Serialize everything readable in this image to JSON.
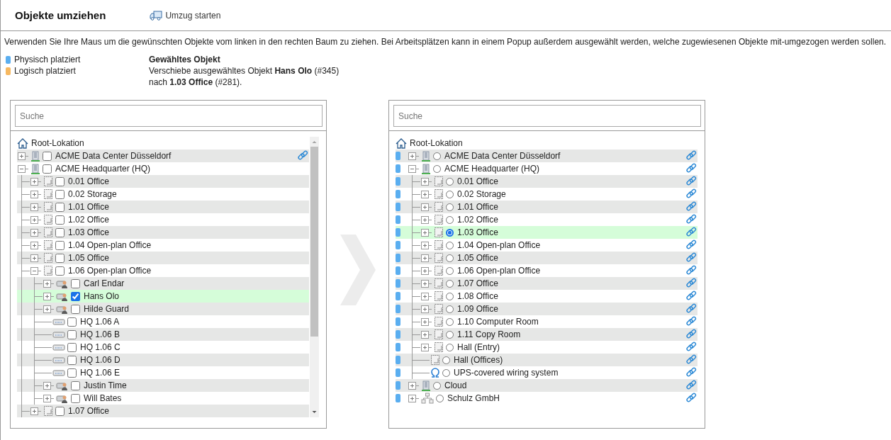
{
  "header": {
    "title": "Objekte umziehen",
    "action": "Umzug starten"
  },
  "instructions": "Verwenden Sie Ihre Maus um die gewünschten Objekte vom linken in den rechten Baum zu ziehen. Bei Arbeitsplätzen kann in einem Popup außerdem ausgewählt werden, welche zugewiesenen Objekte mit-umgezogen werden sollen.",
  "legend": [
    {
      "label": "Physisch platziert",
      "color": "#5aaef0"
    },
    {
      "label": "Logisch platziert",
      "color": "#f6b860"
    }
  ],
  "selection": {
    "title": "Gewähltes Objekt",
    "lines": [
      "Verschiebe ausgewähltes Objekt **Hans Olo** (#345)",
      "nach **1.03 Office** (#281)."
    ]
  },
  "source_tree": {
    "search": {
      "placeholder": "Suche"
    },
    "root": "Root-Lokation",
    "nodes": [
      {
        "label": "ACME Data Center Düsseldorf",
        "kind": "building",
        "expandable": true,
        "expanded": false,
        "checked": false,
        "selected": false,
        "linked": true
      },
      {
        "label": "ACME Headquarter (HQ)",
        "kind": "building",
        "expandable": true,
        "expanded": true,
        "checked": false,
        "selected": false,
        "linked": false,
        "children": [
          {
            "label": "0.01 Office",
            "kind": "room",
            "expandable": true,
            "expanded": false,
            "checked": false,
            "selected": false,
            "linked": false
          },
          {
            "label": "0.02 Storage",
            "kind": "room",
            "expandable": true,
            "expanded": false,
            "checked": false,
            "selected": false,
            "linked": false
          },
          {
            "label": "1.01 Office",
            "kind": "room",
            "expandable": true,
            "expanded": false,
            "checked": false,
            "selected": false,
            "linked": false
          },
          {
            "label": "1.02 Office",
            "kind": "room",
            "expandable": true,
            "expanded": false,
            "checked": false,
            "selected": false,
            "linked": false
          },
          {
            "label": "1.03 Office",
            "kind": "room",
            "expandable": true,
            "expanded": false,
            "checked": false,
            "selected": false,
            "linked": false
          },
          {
            "label": "1.04 Open-plan Office",
            "kind": "room",
            "expandable": true,
            "expanded": false,
            "checked": false,
            "selected": false,
            "linked": false
          },
          {
            "label": "1.05 Office",
            "kind": "room",
            "expandable": true,
            "expanded": false,
            "checked": false,
            "selected": false,
            "linked": false
          },
          {
            "label": "1.06 Open-plan Office",
            "kind": "room",
            "expandable": true,
            "expanded": true,
            "checked": false,
            "selected": false,
            "linked": false,
            "children": [
              {
                "label": "Carl Endar",
                "kind": "person",
                "expandable": true,
                "expanded": false,
                "checked": false,
                "selected": false,
                "linked": false
              },
              {
                "label": "Hans Olo",
                "kind": "person",
                "expandable": true,
                "expanded": false,
                "checked": true,
                "selected": true,
                "linked": false
              },
              {
                "label": "Hilde Guard",
                "kind": "person",
                "expandable": true,
                "expanded": false,
                "checked": false,
                "selected": false,
                "linked": false
              },
              {
                "label": "HQ 1.06 A",
                "kind": "desk",
                "expandable": false,
                "checked": false,
                "selected": false,
                "linked": false
              },
              {
                "label": "HQ 1.06 B",
                "kind": "desk",
                "expandable": false,
                "checked": false,
                "selected": false,
                "linked": false
              },
              {
                "label": "HQ 1.06 C",
                "kind": "desk",
                "expandable": false,
                "checked": false,
                "selected": false,
                "linked": false
              },
              {
                "label": "HQ 1.06 D",
                "kind": "desk",
                "expandable": false,
                "checked": false,
                "selected": false,
                "linked": false
              },
              {
                "label": "HQ 1.06 E",
                "kind": "desk",
                "expandable": false,
                "checked": false,
                "selected": false,
                "linked": false
              },
              {
                "label": "Justin Time",
                "kind": "person",
                "expandable": true,
                "expanded": false,
                "checked": false,
                "selected": false,
                "linked": false
              },
              {
                "label": "Will Bates",
                "kind": "person",
                "expandable": true,
                "expanded": false,
                "checked": false,
                "selected": false,
                "linked": false
              }
            ]
          },
          {
            "label": "1.07 Office",
            "kind": "room",
            "expandable": true,
            "expanded": false,
            "checked": false,
            "selected": false,
            "linked": false
          }
        ]
      }
    ]
  },
  "target_tree": {
    "search": {
      "placeholder": "Suche"
    },
    "root": "Root-Lokation",
    "nodes": [
      {
        "label": "ACME Data Center Düsseldorf",
        "kind": "building",
        "expandable": true,
        "expanded": false,
        "selected": false,
        "linked": true,
        "color": "#5aaef0"
      },
      {
        "label": "ACME Headquarter (HQ)",
        "kind": "building",
        "expandable": true,
        "expanded": true,
        "selected": false,
        "linked": true,
        "color": "#5aaef0",
        "children": [
          {
            "label": "0.01 Office",
            "kind": "room",
            "expandable": true,
            "expanded": false,
            "selected": false,
            "linked": true,
            "color": "#5aaef0"
          },
          {
            "label": "0.02 Storage",
            "kind": "room",
            "expandable": true,
            "expanded": false,
            "selected": false,
            "linked": true,
            "color": "#5aaef0"
          },
          {
            "label": "1.01 Office",
            "kind": "room",
            "expandable": true,
            "expanded": false,
            "selected": false,
            "linked": true,
            "color": "#5aaef0"
          },
          {
            "label": "1.02 Office",
            "kind": "room",
            "expandable": true,
            "expanded": false,
            "selected": false,
            "linked": true,
            "color": "#5aaef0"
          },
          {
            "label": "1.03 Office",
            "kind": "room",
            "expandable": true,
            "expanded": false,
            "selected": true,
            "linked": true,
            "color": "#5aaef0"
          },
          {
            "label": "1.04 Open-plan Office",
            "kind": "room",
            "expandable": true,
            "expanded": false,
            "selected": false,
            "linked": true,
            "color": "#5aaef0"
          },
          {
            "label": "1.05 Office",
            "kind": "room",
            "expandable": true,
            "expanded": false,
            "selected": false,
            "linked": true,
            "color": "#5aaef0"
          },
          {
            "label": "1.06 Open-plan Office",
            "kind": "room",
            "expandable": true,
            "expanded": false,
            "selected": false,
            "linked": true,
            "color": "#5aaef0"
          },
          {
            "label": "1.07 Office",
            "kind": "room",
            "expandable": true,
            "expanded": false,
            "selected": false,
            "linked": true,
            "color": "#5aaef0"
          },
          {
            "label": "1.08 Office",
            "kind": "room",
            "expandable": true,
            "expanded": false,
            "selected": false,
            "linked": true,
            "color": "#5aaef0"
          },
          {
            "label": "1.09 Office",
            "kind": "room",
            "expandable": true,
            "expanded": false,
            "selected": false,
            "linked": true,
            "color": "#5aaef0"
          },
          {
            "label": "1.10 Computer Room",
            "kind": "room",
            "expandable": true,
            "expanded": false,
            "selected": false,
            "linked": true,
            "color": "#5aaef0"
          },
          {
            "label": "1.11 Copy Room",
            "kind": "room",
            "expandable": true,
            "expanded": false,
            "selected": false,
            "linked": true,
            "color": "#5aaef0"
          },
          {
            "label": "Hall (Entry)",
            "kind": "room",
            "expandable": true,
            "expanded": false,
            "selected": false,
            "linked": true,
            "color": "#5aaef0"
          },
          {
            "label": "Hall (Offices)",
            "kind": "room",
            "expandable": false,
            "selected": false,
            "linked": true,
            "color": "#5aaef0"
          },
          {
            "label": "UPS-covered wiring system",
            "kind": "wiring",
            "expandable": false,
            "selected": false,
            "linked": true,
            "color": "#5aaef0"
          }
        ]
      },
      {
        "label": "Cloud",
        "kind": "building",
        "expandable": true,
        "expanded": false,
        "selected": false,
        "linked": true,
        "color": "#5aaef0"
      },
      {
        "label": "Schulz GmbH",
        "kind": "org",
        "expandable": true,
        "expanded": false,
        "selected": false,
        "linked": true,
        "color": "#5aaef0"
      }
    ]
  }
}
